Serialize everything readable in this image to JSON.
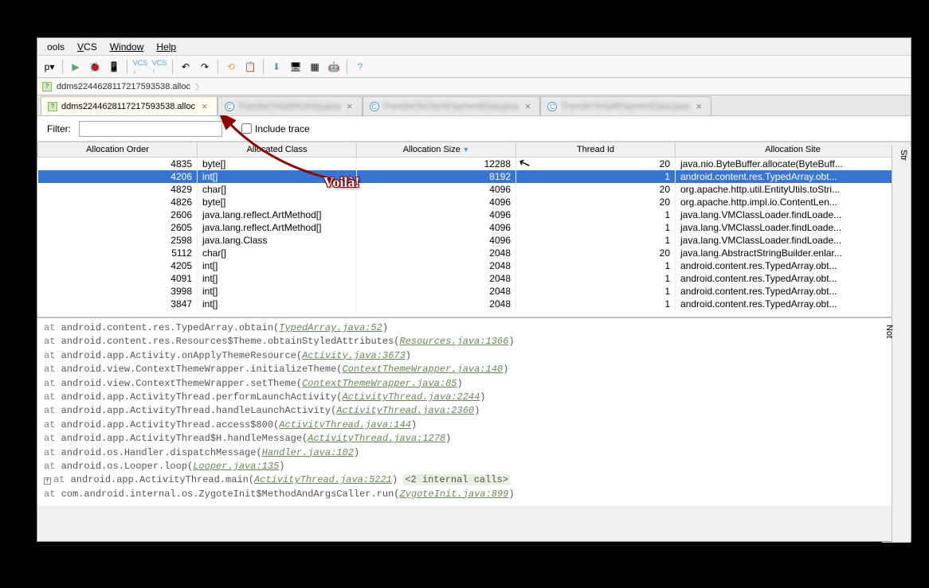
{
  "menu": {
    "items": [
      "ools",
      "VCS",
      "Window",
      "Help"
    ],
    "p_label": "p"
  },
  "breadcrumb": "ddms2244628117217593538.alloc",
  "tabs": [
    {
      "label": "ddms2244628117217593538.alloc",
      "active": true,
      "icon": "file"
    },
    {
      "label": "TransferToSelfActivity.java",
      "active": false,
      "icon": "c",
      "blurred": true
    },
    {
      "label": "TransferToClientPaymentData.java",
      "active": false,
      "icon": "c",
      "blurred": true
    },
    {
      "label": "TransferToSelfPaymentData.java",
      "active": false,
      "icon": "c",
      "blurred": true
    }
  ],
  "filter": {
    "label": "Filter:",
    "value": "",
    "include_trace": "Include trace"
  },
  "columns": [
    "Allocation Order",
    "Allocated Class",
    "Allocation Size",
    "Thread Id",
    "Allocation Site"
  ],
  "rows": [
    {
      "order": 4835,
      "class": "byte[]",
      "size": 12288,
      "thread": 20,
      "site": "java.nio.ByteBuffer.allocate(ByteBuff...",
      "selected": false
    },
    {
      "order": 4206,
      "class": "int[]",
      "size": 8192,
      "thread": 1,
      "site": "android.content.res.TypedArray.obt...",
      "selected": true
    },
    {
      "order": 4829,
      "class": "char[]",
      "size": 4096,
      "thread": 20,
      "site": "org.apache.http.util.EntityUtils.toStri...",
      "selected": false
    },
    {
      "order": 4826,
      "class": "byte[]",
      "size": 4096,
      "thread": 20,
      "site": "org.apache.http.impl.io.ContentLen...",
      "selected": false
    },
    {
      "order": 2606,
      "class": "java.lang.reflect.ArtMethod[]",
      "size": 4096,
      "thread": 1,
      "site": "java.lang.VMClassLoader.findLoade...",
      "selected": false
    },
    {
      "order": 2605,
      "class": "java.lang.reflect.ArtMethod[]",
      "size": 4096,
      "thread": 1,
      "site": "java.lang.VMClassLoader.findLoade...",
      "selected": false
    },
    {
      "order": 2598,
      "class": "java.lang.Class",
      "size": 4096,
      "thread": 1,
      "site": "java.lang.VMClassLoader.findLoade...",
      "selected": false
    },
    {
      "order": 5112,
      "class": "char[]",
      "size": 2048,
      "thread": 20,
      "site": "java.lang.AbstractStringBuilder.enlar...",
      "selected": false
    },
    {
      "order": 4205,
      "class": "int[]",
      "size": 2048,
      "thread": 1,
      "site": "android.content.res.TypedArray.obt...",
      "selected": false
    },
    {
      "order": 4091,
      "class": "int[]",
      "size": 2048,
      "thread": 1,
      "site": "android.content.res.TypedArray.obt...",
      "selected": false
    },
    {
      "order": 3998,
      "class": "int[]",
      "size": 2048,
      "thread": 1,
      "site": "android.content.res.TypedArray.obt...",
      "selected": false
    },
    {
      "order": 3847,
      "class": "int[]",
      "size": 2048,
      "thread": 1,
      "site": "android.content.res.TypedArray.obt...",
      "selected": false
    }
  ],
  "stack": [
    {
      "at": "at",
      "method": "android.content.res.TypedArray.obtain",
      "link": "TypedArray.java:52"
    },
    {
      "at": "at",
      "method": "android.content.res.Resources$Theme.obtainStyledAttributes",
      "link": "Resources.java:1366"
    },
    {
      "at": "at",
      "method": "android.app.Activity.onApplyThemeResource",
      "link": "Activity.java:3673"
    },
    {
      "at": "at",
      "method": "android.view.ContextThemeWrapper.initializeTheme",
      "link": "ContextThemeWrapper.java:140"
    },
    {
      "at": "at",
      "method": "android.view.ContextThemeWrapper.setTheme",
      "link": "ContextThemeWrapper.java:85"
    },
    {
      "at": "at",
      "method": "android.app.ActivityThread.performLaunchActivity",
      "link": "ActivityThread.java:2244"
    },
    {
      "at": "at",
      "method": "android.app.ActivityThread.handleLaunchActivity",
      "link": "ActivityThread.java:2360"
    },
    {
      "at": "at",
      "method": "android.app.ActivityThread.access$800",
      "link": "ActivityThread.java:144"
    },
    {
      "at": "at",
      "method": "android.app.ActivityThread$H.handleMessage",
      "link": "ActivityThread.java:1278"
    },
    {
      "at": "at",
      "method": "android.os.Handler.dispatchMessage",
      "link": "Handler.java:102"
    },
    {
      "at": "at",
      "method": "android.os.Looper.loop",
      "link": "Looper.java:135"
    },
    {
      "at": "at",
      "method": "android.app.ActivityThread.main",
      "link": "ActivityThread.java:5221",
      "suffix": "<2 internal calls>",
      "expand": true
    },
    {
      "at": "at",
      "method": "com.android.internal.os.ZygoteInit$MethodAndArgsCaller.run",
      "link": "ZygoteInit.java:899"
    }
  ],
  "side": {
    "str": "Str",
    "not": "Not"
  },
  "annotation": "Voilà!"
}
